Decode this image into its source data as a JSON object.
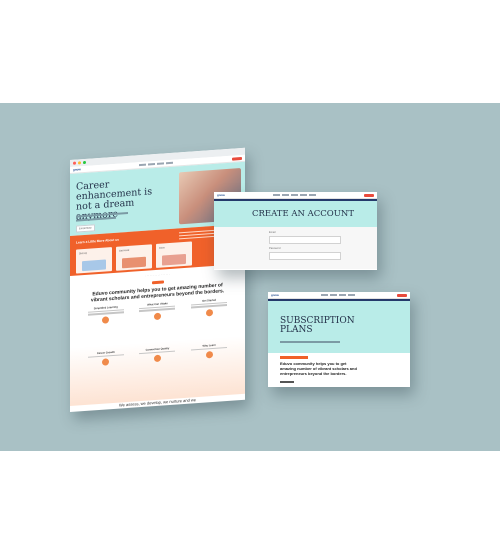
{
  "home_page": {
    "logo": "gnow",
    "hero_title": "Career enhancement is not a dream anymore",
    "hero_button": "Enroll Now",
    "section_title": "Learn a Little More About us",
    "tiles": [
      {
        "label": "Skill Up",
        "color": "#a8c8e8"
      },
      {
        "label": "Get Hired",
        "color": "#e89070"
      },
      {
        "label": "Grow",
        "color": "#e8a090"
      }
    ],
    "tagline": "Eduvo community helps you to get amazing number of vibrant scholars and entrepreneurs beyond the borders.",
    "features": [
      {
        "title": "Simplified Learning"
      },
      {
        "title": "What Can I Make"
      },
      {
        "title": "Get Started"
      }
    ],
    "features_row2": [
      {
        "title": "Career Growth"
      },
      {
        "title": "Connection Quality"
      },
      {
        "title": "Why Learn"
      }
    ],
    "footer_text": "We assess, we develop, we nurture and we"
  },
  "account_page": {
    "logo": "gnow",
    "title": "CREATE AN ACCOUNT",
    "fields": [
      "Email",
      "Password"
    ]
  },
  "subscription_page": {
    "title": "SUBSCRIPTION PLANS",
    "tagline": "Eduvo community helps you to get amazing number of vibrant scholars and entrepreneurs beyond the borders."
  },
  "colors": {
    "accent_orange": "#f0612a",
    "hero_teal": "#b9ece8",
    "navy": "#253a6b",
    "background": "#a9c1c5"
  }
}
